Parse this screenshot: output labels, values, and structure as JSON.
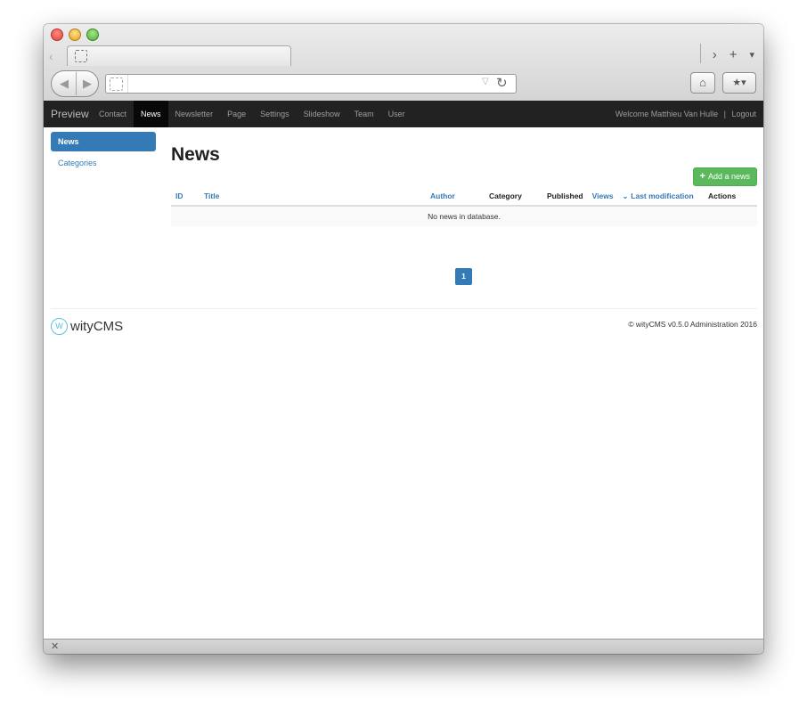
{
  "browser": {
    "tabbar": {
      "back_glyph": "‹",
      "forward_glyph": "›",
      "new_tab_glyph": "+",
      "menu_glyph": "▾"
    },
    "toolbar": {
      "back_glyph": "◀",
      "forward_glyph": "▶",
      "dropdown_glyph": "▽",
      "reload_glyph": "↻",
      "home_glyph": "⌂",
      "bookmark_glyph": "★▾",
      "address_value": ""
    },
    "statusbar": {
      "close_glyph": "✕"
    }
  },
  "navbar": {
    "brand": "Preview",
    "items": [
      {
        "label": "Contact"
      },
      {
        "label": "News"
      },
      {
        "label": "Newsletter"
      },
      {
        "label": "Page"
      },
      {
        "label": "Settings"
      },
      {
        "label": "Slideshow"
      },
      {
        "label": "Team"
      },
      {
        "label": "User"
      }
    ],
    "active_item": "News",
    "welcome": "Welcome Matthieu Van Hulle",
    "separator": "|",
    "logout": "Logout"
  },
  "sidebar": {
    "items": [
      {
        "label": "News",
        "active": true
      },
      {
        "label": "Categories",
        "active": false
      }
    ]
  },
  "main": {
    "title": "News",
    "add_button": {
      "icon": "+",
      "label": "Add a news"
    },
    "table": {
      "columns": [
        {
          "label": "ID",
          "sortable": true
        },
        {
          "label": "Title",
          "sortable": true
        },
        {
          "label": "Author",
          "sortable": true
        },
        {
          "label": "Category",
          "sortable": false
        },
        {
          "label": "Published",
          "sortable": false
        },
        {
          "label": "Views",
          "sortable": true
        },
        {
          "label": "Last modification",
          "sortable": true,
          "sorted": true
        },
        {
          "label": "Actions",
          "sortable": false
        }
      ],
      "sort_glyph": "⌄",
      "empty_message": "No news in database."
    },
    "pagination": {
      "current": "1"
    }
  },
  "footer": {
    "logo_text": "wityCMS",
    "logo_mark": "W",
    "copyright": "© wityCMS v0.5.0 Administration 2016"
  },
  "colors": {
    "navbar_bg": "#222222",
    "primary": "#337ab7",
    "success": "#5cb85c"
  }
}
